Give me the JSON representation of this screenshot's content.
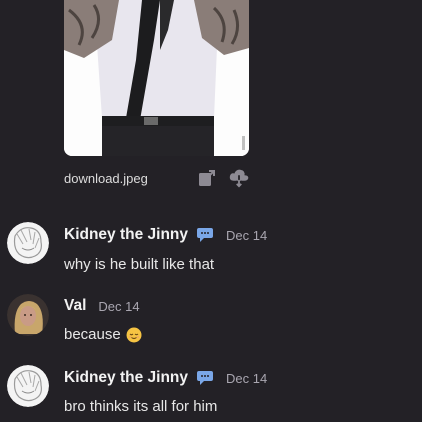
{
  "attachment": {
    "file_name": "download.jpeg",
    "icons": [
      "open-external-icon",
      "cloud-download-icon"
    ]
  },
  "messages": [
    {
      "username": "Kidney the Jinny",
      "badge_icon": "chat-bubble-icon",
      "timestamp": "Dec 14",
      "text": "why is he built like that"
    },
    {
      "username": "Val",
      "timestamp": "Dec 14",
      "text": "because",
      "emoji": "relieved-face-emoji"
    },
    {
      "username": "Kidney the Jinny",
      "badge_icon": "chat-bubble-icon",
      "timestamp": "Dec 14",
      "text": "bro thinks its all for him"
    }
  ],
  "colors": {
    "background": "#232126",
    "username": "#f2f2f2",
    "timestamp": "#a9a6b0",
    "badge": "#7aa7e8",
    "emoji": "#f6c443"
  }
}
